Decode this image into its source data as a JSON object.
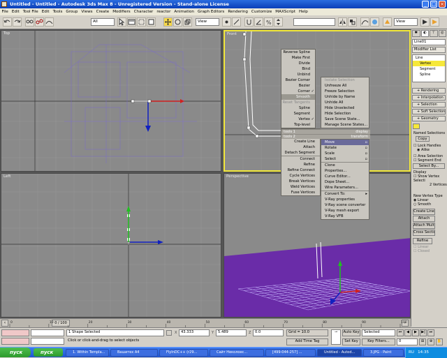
{
  "window": {
    "title": "Untitled - Untitled - Autodesk 3ds Max 8 - Unregistered Version - Stand-alone License"
  },
  "menu": [
    "File",
    "Edit",
    "Tool File",
    "Edit",
    "Tools",
    "Group",
    "Views",
    "Create",
    "Modifiers",
    "Character",
    "reactor",
    "Animation",
    "Graph Editors",
    "Rendering",
    "Customize",
    "MAXScript",
    "Help"
  ],
  "toolbar": {
    "selection_filter": "All",
    "coord_system": "View",
    "named_selection": "",
    "render_view": "View"
  },
  "viewports": {
    "top": "Top",
    "front": "Front",
    "left": "Left",
    "perspective": "Perspective"
  },
  "quadmenu": {
    "left_items": [
      {
        "label": "Reverse Spline"
      },
      {
        "label": "Make First"
      },
      {
        "label": "Divide"
      },
      {
        "label": "Bind"
      },
      {
        "label": "Unbind"
      },
      {
        "label": "Bezier Corner"
      },
      {
        "label": "Bezier"
      },
      {
        "label": "Corner",
        "check": true
      },
      {
        "label": "Smooth",
        "hl": true
      },
      {
        "label": "Reset Tangents",
        "dis": true
      },
      {
        "label": "Spline"
      },
      {
        "label": "Segment"
      },
      {
        "label": "Vertex",
        "check": true
      },
      {
        "label": "Top-level"
      }
    ],
    "right_items": [
      {
        "label": "Isolate Selection",
        "dis": true
      },
      {
        "label": "Unfreeze All"
      },
      {
        "label": "Freeze Selection"
      },
      {
        "label": "Unhide by Name"
      },
      {
        "label": "Unhide All"
      },
      {
        "label": "Hide Unselected"
      },
      {
        "label": "Hide Selection"
      },
      {
        "label": "Save Scene State..."
      },
      {
        "label": "Manage Scene States..."
      }
    ],
    "headers": {
      "tools1": "tools 1",
      "display": "display",
      "tools2": "tools 2",
      "transform": "transform"
    },
    "left_bottom": [
      {
        "label": "Create Line"
      },
      {
        "label": "Attach"
      },
      {
        "label": "Detach Segment"
      },
      {
        "label": "Connect",
        "sep": true
      },
      {
        "label": "Refine"
      },
      {
        "label": "Refine Connect"
      },
      {
        "label": "Cycle Vertices"
      },
      {
        "label": "Break Vertices"
      },
      {
        "label": "Weld Vertices"
      },
      {
        "label": "Fuse Vertices"
      }
    ],
    "right_bottom": [
      {
        "label": "Move",
        "hl": true
      },
      {
        "label": "Rotate"
      },
      {
        "label": "Scale"
      },
      {
        "label": "Select"
      },
      {
        "label": "Clone",
        "sep": true
      },
      {
        "label": "Properties..."
      },
      {
        "label": "Curve Editor..."
      },
      {
        "label": "Dope Sheet..."
      },
      {
        "label": "Wire Parameters..."
      },
      {
        "label": "Convert To:",
        "sep": true
      },
      {
        "label": "V-Ray properties"
      },
      {
        "label": "V-Ray scene converter"
      },
      {
        "label": "V-Ray mesh export"
      },
      {
        "label": "V-Ray VFB"
      }
    ]
  },
  "panel": {
    "object_name": "Line01",
    "modifier_list": "Modifier List",
    "stack": [
      "Line",
      "Vertex",
      "Segment",
      "Spline"
    ],
    "rollouts": [
      "Rendering",
      "Interpolation",
      "Selection",
      "Soft Selection",
      "Geometry"
    ],
    "selection": {
      "named_sel": "Named Selections",
      "copy": "Copy",
      "lock": "Lock Handles",
      "alike": "Alike",
      "area_sel": "Area Selection",
      "seg_end": "Segment End",
      "select_by": "Select By...",
      "display": "Display",
      "show_vertex": "Show Vertex",
      "sel": "Selecti",
      "vertices": "2 Vertices"
    },
    "geometry": {
      "new_vertex_type": "New Vertex Type",
      "linear": "Linear",
      "smooth": "Smooth",
      "create_line": "Create Line",
      "attach": "Attach",
      "attach_mult": "Attach Mult.",
      "cross_section": "Cross Section",
      "refine": "Refine",
      "linear2": "Linear",
      "closed": "Closed"
    }
  },
  "timeline": {
    "frame": "0 / 100",
    "ticks": [
      "0",
      "10",
      "20",
      "30",
      "40",
      "50",
      "60",
      "70",
      "80",
      "90",
      "100"
    ]
  },
  "status": {
    "selected": "1 Shape Selected",
    "prompt": "Click or click-and-drag to select objects",
    "x": "43.333",
    "y": "5.489",
    "z": "0.0",
    "grid": "Grid = 10.0",
    "add_time_tag": "Add Time Tag",
    "auto_key": "Auto Key",
    "set_key": "Set Key",
    "key_mode": "Selected",
    "key_filters": "Key Filters...",
    "frame": "0"
  },
  "taskbar": {
    "start": "пуск",
    "tasks": [
      "1. Within Templa...",
      "Вашитех А4",
      "FlyInDC++ (r29...",
      "Сайт Неколоес...",
      "[499-044-257] ...",
      "Untitled - Autod...",
      "3.JPG - Paint"
    ],
    "lang": "RU",
    "time": "14:35"
  },
  "colors": {
    "viewport_bg": "#8a8a8a",
    "active_viewport": "#f2e83a",
    "perspective_ground": "#6a2ca8",
    "grid_lines": "#6a6acc",
    "spline": "#ffffff"
  }
}
